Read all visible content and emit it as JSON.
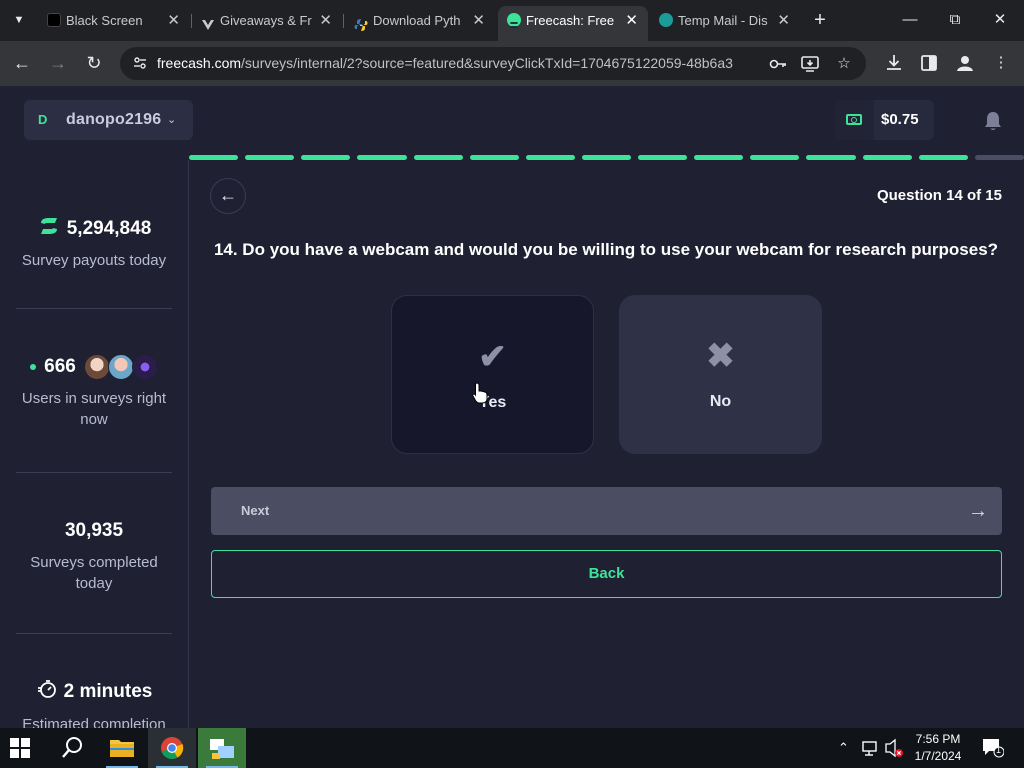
{
  "browser": {
    "tabs": [
      {
        "title": "Black Screen",
        "favicon": "black-square"
      },
      {
        "title": "Giveaways & Fr",
        "favicon": "v-logo"
      },
      {
        "title": "Download Pyth",
        "favicon": "python-logo"
      },
      {
        "title": "Freecash: Free",
        "favicon": "freecash-logo",
        "active": true
      },
      {
        "title": "Temp Mail - Dis",
        "favicon": "tempmail-logo"
      }
    ],
    "url_host": "freecash.com",
    "url_path": "/surveys/internal/2?source=featured&surveyClickTxId=1704675122059-48b6a3"
  },
  "header": {
    "user_initial": "D",
    "username": "danopo2196",
    "balance": "$0.75"
  },
  "progress": {
    "completed": 14,
    "total": 15
  },
  "sidebar": {
    "payouts_value": "5,294,848",
    "payouts_label": "Survey payouts today",
    "users_value": "666",
    "users_label": "Users in surveys right now",
    "completed_value": "30,935",
    "completed_label": "Surveys completed today",
    "estimated_value": "2 minutes",
    "estimated_label": "Estimated completion"
  },
  "survey": {
    "question_counter": "Question 14 of 15",
    "question": "14. Do you have a webcam and would you be willing to use your webcam for research purposes?",
    "options": [
      {
        "label": "Yes",
        "icon": "check-icon",
        "selected": true
      },
      {
        "label": "No",
        "icon": "x-icon",
        "selected": false
      }
    ],
    "next_label": "Next",
    "back_label": "Back"
  },
  "taskbar": {
    "time": "7:56 PM",
    "date": "1/7/2024",
    "notification_count": "1"
  },
  "colors": {
    "accent": "#3ee39a",
    "page_bg": "#1f2031",
    "progress_inactive": "#4b4d63"
  }
}
